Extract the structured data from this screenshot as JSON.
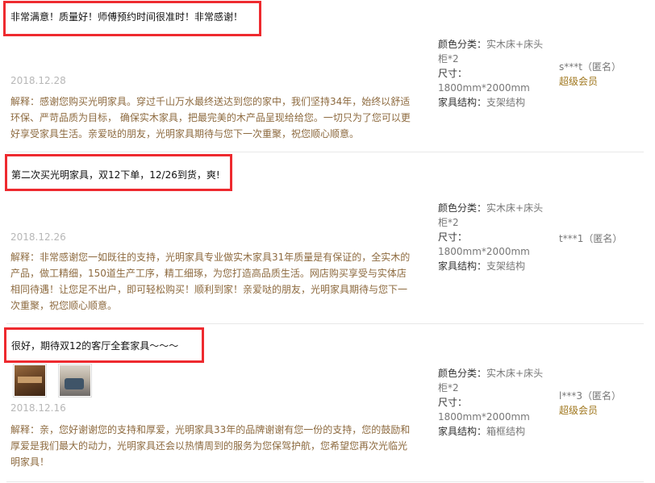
{
  "reviews": [
    {
      "content": "非常满意！质量好！师傅预约时间很准时！非常感谢！",
      "date": "2018.12.28",
      "reply": "解释：感谢您购买光明家具。穿过千山万水最终送达到您的家中，我们坚持34年，始终以舒适环保、严苛品质为目标， 确保实木家具，把最完美的木产品呈现给给您。一切只为了您可以更好享受家具生活。亲爱哒的朋友，光明家具期待与您下一次重聚，祝您顺心顺意。",
      "color_label": "颜色分类：",
      "color_value": "实木床+床头柜*2",
      "size_label": "尺寸：",
      "size_value": "1800mm*2000mm",
      "structure_label": "家具结构：",
      "structure_value": "支架结构",
      "user": "s***t（匿名）",
      "member": "超级会员"
    },
    {
      "content": "第二次买光明家具，双12下单，12/26到货，爽!",
      "date": "2018.12.26",
      "reply": "解释：非常感谢您一如既往的支持，光明家具专业做实木家具31年质量是有保证的，全实木的产品，做工精细，150道生产工序，精工细琢，为您打造高品质生活。网店购买享受与实体店相同待遇！让您足不出户，即可轻松购买！顺利到家！亲爱哒的朋友，光明家具期待与您下一次重聚，祝您顺心顺意。",
      "color_label": "颜色分类：",
      "color_value": "实木床+床头柜*2",
      "size_label": "尺寸：",
      "size_value": "1800mm*2000mm",
      "structure_label": "家具结构：",
      "structure_value": "支架结构",
      "user": "t***1（匿名）",
      "member": ""
    },
    {
      "content": "很好，期待双12的客厅全套家具～～～",
      "date": "2018.12.16",
      "reply": "解释：亲，您好谢谢您的支持和厚爱，光明家具33年的品牌谢谢有您一份的支持，您的鼓励和厚爱是我们最大的动力，光明家具还会以热情周到的服务为您保驾护航，您希望您再次光临光明家具！",
      "color_label": "颜色分类：",
      "color_value": "实木床+床头柜*2",
      "size_label": "尺寸：",
      "size_value": "1800mm*2000mm",
      "structure_label": "家具结构：",
      "structure_value": "箱框结构",
      "user": "l***3（匿名）",
      "member": "超级会员"
    }
  ],
  "colors": {
    "highlight": "#ee2a2f",
    "reply": "#8d6a3f",
    "vip": "#a0771e"
  }
}
